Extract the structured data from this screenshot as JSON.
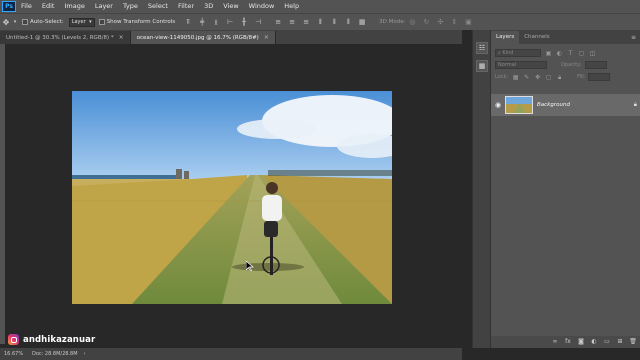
{
  "app": {
    "logo": "Ps"
  },
  "menu": [
    "File",
    "Edit",
    "Image",
    "Layer",
    "Type",
    "Select",
    "Filter",
    "3D",
    "View",
    "Window",
    "Help"
  ],
  "options": {
    "move_tool_icon": "move-icon",
    "auto_select_label": "Auto-Select:",
    "auto_select_target": "Layer",
    "show_transform_label": "Show Transform Controls",
    "mode_3d_label": "3D Mode:"
  },
  "tabs": [
    {
      "label": "Untitled-1 @ 30.3% (Levels 2, RGB/8) *",
      "active": false
    },
    {
      "label": "ocean-view-1149050.jpg @ 16.7% (RGB/8#)",
      "active": true
    }
  ],
  "panel": {
    "tabs": [
      "Layers",
      "Channels"
    ],
    "kind_placeholder": "Kind",
    "blend_mode": "Normal",
    "opacity_label": "Opacity:",
    "lock_label": "Lock:",
    "fill_label": "Fill:",
    "layer_name": "Background"
  },
  "status": {
    "zoom": "16.67%",
    "doc_info": "Doc: 28.8M/28.8M"
  },
  "watermark": {
    "handle": "andhikazanuar",
    "icon": "instagram-icon"
  },
  "colors": {
    "ui_dark": "#282828",
    "ui_panel": "#535353",
    "ps_blue": "#31a8ff",
    "layer_selected": "#696969"
  }
}
